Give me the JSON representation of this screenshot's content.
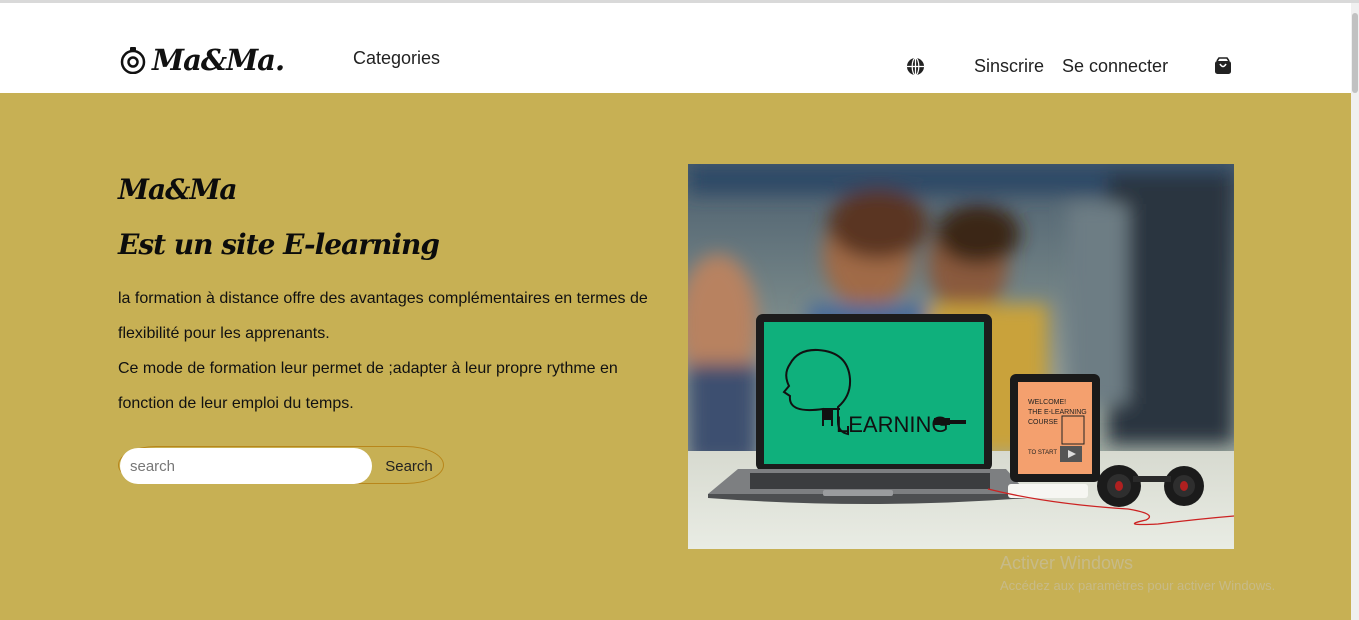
{
  "header": {
    "logo_text": "Ma&Ma.",
    "nav_categories": "Categories",
    "signup": "Sinscrire",
    "signin": "Se connecter",
    "icons": [
      "camera-logo-icon",
      "globe-icon",
      "shopping-bag-icon"
    ]
  },
  "hero": {
    "title_line1": "Ma&Ma",
    "title_line2": "Est un site E-learning",
    "para_line1": "la formation à distance offre des avantages complémentaires en termes de flexibilité pour les apprenants.",
    "para_line2": "Ce mode de formation leur permet de ;adapter à leur propre rythme en fonction de leur emploi du temps.",
    "search_placeholder": "search",
    "search_button": "Search",
    "background_color": "#c7b054",
    "image": {
      "screen_text": "LEARNING",
      "tablet_text_1": "WELCOME!",
      "tablet_text_2": "THE E-LEARNING",
      "tablet_text_3": "COURSE",
      "tablet_text_4": "TO START"
    }
  },
  "watermark": {
    "line1": "Activer Windows",
    "line2": "Accédez aux paramètres pour activer Windows."
  }
}
